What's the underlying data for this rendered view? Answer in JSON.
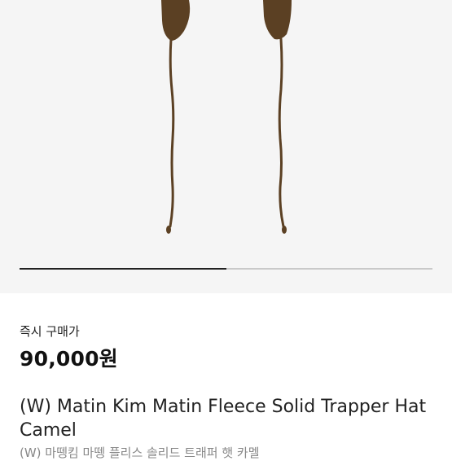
{
  "product": {
    "image_alt": "Matin Kim Fleece Trapper Hat straps",
    "gallery_progress": 0.5
  },
  "price": {
    "label": "즉시 구매가",
    "value": "90,000원"
  },
  "title": {
    "english": "(W) Matin Kim Matin Fleece Solid Trapper Hat Camel",
    "korean": "(W) 마뗑킴 마뗑 플리스 솔리드 트래퍼 햇 카멜"
  },
  "colors": {
    "image_bg": "#f5f5f5",
    "strap": "#5b4023",
    "progress_track": "#c9c9c9",
    "progress_fill": "#222222"
  }
}
